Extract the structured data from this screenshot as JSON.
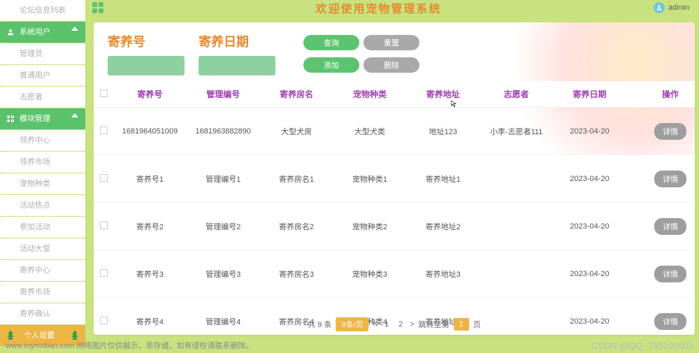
{
  "app": {
    "title": "欢迎使用宠物管理系统",
    "username": "admin"
  },
  "sidebar": {
    "top": "论坛信息列表",
    "group1": {
      "label": "系统用户",
      "items": [
        "管理员",
        "普通用户",
        "志愿者"
      ]
    },
    "group2": {
      "label": "模块管理",
      "items": [
        "领养中心",
        "领养市场",
        "宠物种类",
        "活动热点",
        "参加活动",
        "活动大堂",
        "寄养中心",
        "寄养市场",
        "寄养确认"
      ]
    },
    "last": "个人设置"
  },
  "search": {
    "label_code": "寄养号",
    "label_date": "寄养日期",
    "input_code": "",
    "input_date": "",
    "buttons": {
      "query": "查询",
      "reset": "重置",
      "add": "添加",
      "delete": "删除"
    }
  },
  "table": {
    "headers": [
      "寄养号",
      "管理编号",
      "寄养房名",
      "宠物种类",
      "寄养地址",
      "志愿者",
      "寄养日期",
      "",
      "操作"
    ],
    "detail_label": "详情",
    "rows": [
      {
        "c1": "1681964051009",
        "c2": "1681963882890",
        "c3": "大型犬房",
        "c4": "大型犬类",
        "c5": "地址123",
        "c6": "小李-志愿者111",
        "c7": "2023-04-20"
      },
      {
        "c1": "寄养号1",
        "c2": "管理编号1",
        "c3": "寄养房名1",
        "c4": "宠物种类1",
        "c5": "寄养地址1",
        "c6": "",
        "c7": "2023-04-20"
      },
      {
        "c1": "寄养号2",
        "c2": "管理编号2",
        "c3": "寄养房名2",
        "c4": "宠物种类2",
        "c5": "寄养地址2",
        "c6": "",
        "c7": "2023-04-20"
      },
      {
        "c1": "寄养号3",
        "c2": "管理编号3",
        "c3": "寄养房名3",
        "c4": "宠物种类3",
        "c5": "寄养地址3",
        "c6": "",
        "c7": "2023-04-20"
      },
      {
        "c1": "寄养号4",
        "c2": "管理编号4",
        "c3": "寄养房名4",
        "c4": "宠物种类4",
        "c5": "寄养地址4",
        "c6": "",
        "c7": "2023-04-20"
      }
    ]
  },
  "pager": {
    "total_text": "共 9 条",
    "per_page": "9条/页",
    "pages": [
      "1",
      "2"
    ],
    "jump_text": "跳转至第",
    "current": "1",
    "suffix": "页"
  },
  "watermark": {
    "left": "www.toymoban.com 网络图片仅供展示，非存储，如有侵权请联系删除。",
    "right": "CSDN @QQ_785101505"
  }
}
